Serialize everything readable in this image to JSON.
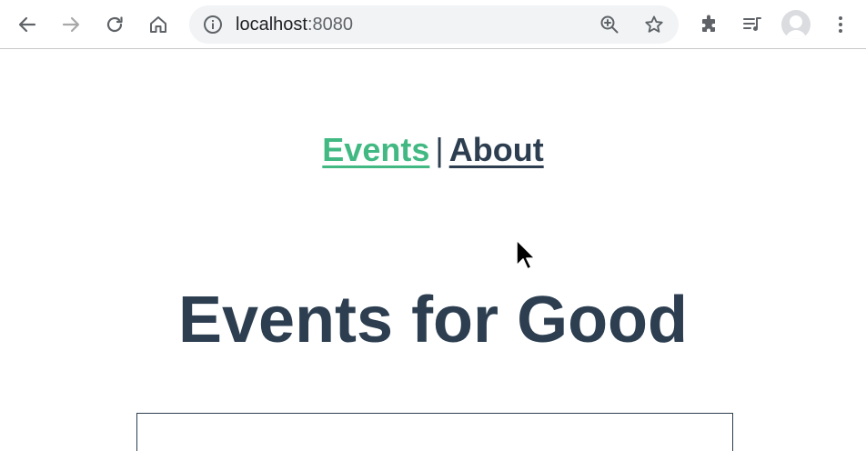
{
  "browser": {
    "url_host": "localhost",
    "url_port": ":8080",
    "icons": {
      "back": "arrow-left-icon",
      "forward": "arrow-right-icon",
      "reload": "reload-icon",
      "home": "home-icon",
      "info": "info-icon",
      "zoom": "zoom-in-icon",
      "bookmark": "star-icon",
      "extensions": "puzzle-icon",
      "media": "media-queue-icon",
      "profile": "avatar",
      "menu": "kebab-menu-icon"
    }
  },
  "nav": {
    "events_label": "Events",
    "separator": "|",
    "about_label": "About"
  },
  "main": {
    "title": "Events for Good"
  },
  "colors": {
    "accent": "#42b983",
    "text": "#2c3e50"
  }
}
